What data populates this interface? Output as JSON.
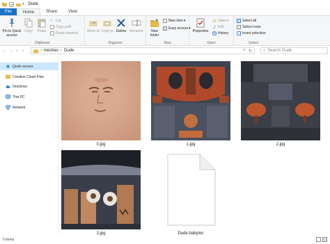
{
  "window": {
    "title": "Dude"
  },
  "tabs": [
    {
      "label": "File"
    },
    {
      "label": "Home"
    },
    {
      "label": "Share"
    },
    {
      "label": "View"
    }
  ],
  "ribbon": {
    "clipboard": {
      "label": "Clipboard",
      "pin": "Pin to Quick access",
      "copy": "Copy",
      "paste": "Paste",
      "cut": "Cut",
      "copy_path": "Copy path",
      "paste_shortcut": "Paste shortcut"
    },
    "organize": {
      "label": "Organize",
      "move_to": "Move to",
      "copy_to": "Copy to",
      "delete": "Delete",
      "rename": "Rename"
    },
    "new": {
      "label": "New",
      "new_folder": "New folder",
      "new_item": "New item",
      "easy_access": "Easy access"
    },
    "open": {
      "label": "Open",
      "properties": "Properties",
      "open": "Open",
      "edit": "Edit",
      "history": "History"
    },
    "select": {
      "label": "Select",
      "select_all": "Select all",
      "select_none": "Select none",
      "invert_selection": "Invert selection"
    }
  },
  "address": {
    "path": [
      "meshes",
      "Dude"
    ],
    "search_placeholder": "Search Dude"
  },
  "nav": [
    {
      "label": "Quick access",
      "icon": "star-icon"
    },
    {
      "label": "Creative Cloud Files",
      "icon": "creative-cloud-icon"
    },
    {
      "label": "OneDrive",
      "icon": "cloud-icon"
    },
    {
      "label": "This PC",
      "icon": "computer-icon"
    },
    {
      "label": "Network",
      "icon": "network-icon"
    }
  ],
  "files": [
    {
      "name": "0.jpg"
    },
    {
      "name": "1.jpg"
    },
    {
      "name": "2.jpg"
    },
    {
      "name": "3.jpg"
    },
    {
      "name": "Dude.babylon"
    }
  ],
  "status": {
    "count": "5 items"
  },
  "colors": {
    "accent": "#1a73c8",
    "selected": "#cce8ff"
  }
}
